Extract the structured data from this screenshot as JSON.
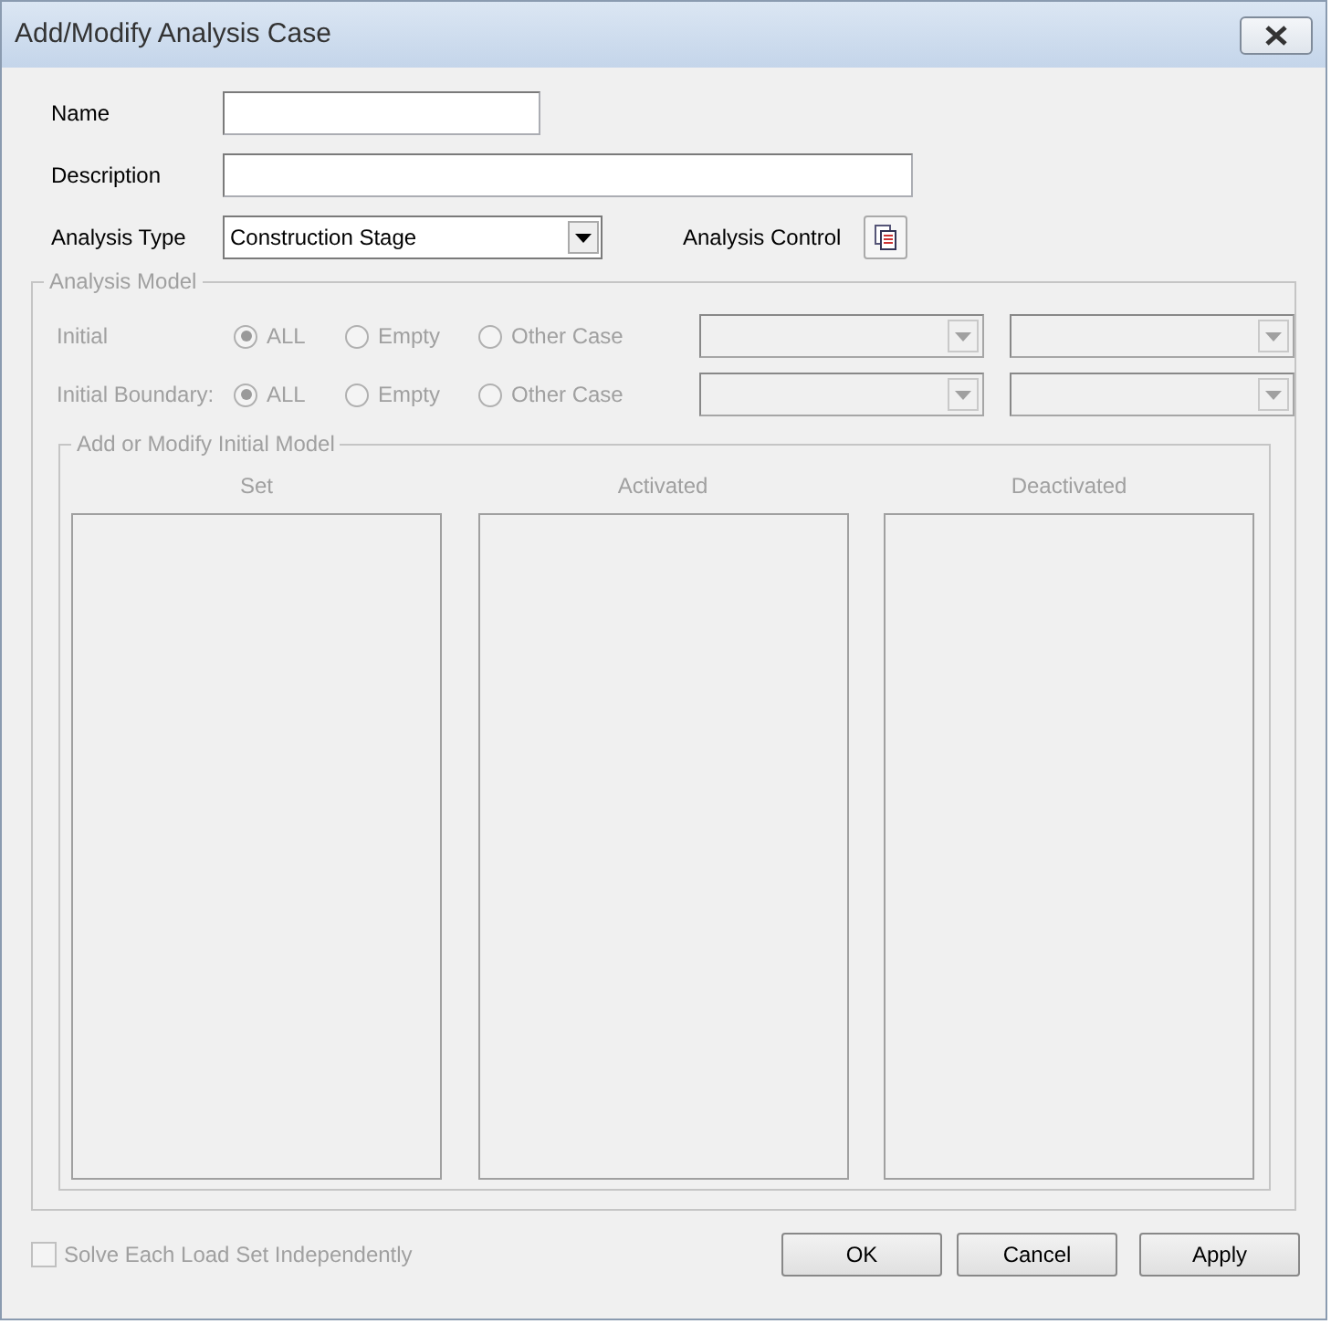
{
  "window": {
    "title": "Add/Modify Analysis Case"
  },
  "fields": [
    {
      "label": "Name",
      "kind": "short"
    },
    {
      "label": "Description",
      "kind": "long"
    }
  ],
  "analysis_type": {
    "label": "Analysis Type",
    "value": "Construction Stage"
  },
  "analysis_control": {
    "label": "Analysis Control"
  },
  "analysis_model": {
    "title": "Analysis Model",
    "disabled": true,
    "rows": [
      {
        "label": "Initial",
        "options": [
          {
            "label": "ALL",
            "selected": true
          },
          {
            "label": "Empty",
            "selected": false
          },
          {
            "label": "Other Case",
            "selected": false
          }
        ]
      },
      {
        "label": "Initial Boundary:",
        "options": [
          {
            "label": "ALL",
            "selected": true
          },
          {
            "label": "Empty",
            "selected": false
          },
          {
            "label": "Other Case",
            "selected": false
          }
        ]
      }
    ],
    "initial_model": {
      "title": "Add or Modify Initial Model",
      "columns": [
        {
          "heading": "Set"
        },
        {
          "heading": "Activated"
        },
        {
          "heading": "Deactivated"
        }
      ]
    }
  },
  "solve_independently": {
    "label": "Solve Each Load Set Independently",
    "checked": false,
    "disabled": true
  },
  "buttons": [
    "OK",
    "Cancel",
    "Apply"
  ]
}
